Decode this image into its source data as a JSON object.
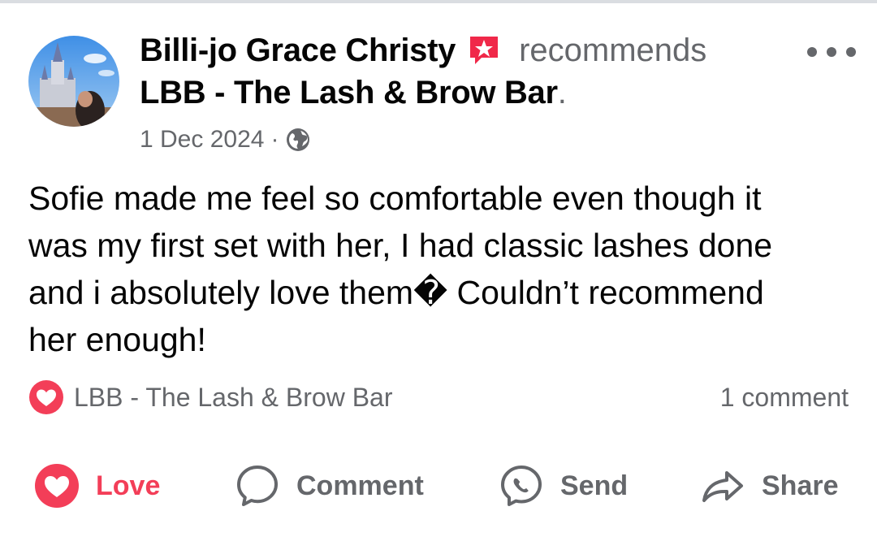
{
  "post": {
    "author": "Billi-jo Grace Christy",
    "verb": "recommends",
    "page_name": "LBB - The Lash & Brow Bar",
    "page_suffix": ".",
    "date": "1 Dec 2024",
    "separator": "·",
    "privacy_icon": "globe-icon",
    "recommend_icon": "recommendation-star-icon",
    "text_lines": [
      "Sofie made me feel so comfortable even though it",
      "was my first set with her, I had classic lashes done",
      "and i absolutely love them� Couldn’t recommend",
      "her enough!"
    ]
  },
  "reactions": {
    "icon": "love-reaction-icon",
    "reactor": "LBB - The Lash & Brow Bar",
    "comment_count": "1 comment"
  },
  "actions": {
    "love": "Love",
    "comment": "Comment",
    "send": "Send",
    "share": "Share"
  },
  "colors": {
    "love": "#f33e58",
    "recommend_badge": "#f02849",
    "secondary_text": "#65676b",
    "primary_text": "#050505"
  }
}
